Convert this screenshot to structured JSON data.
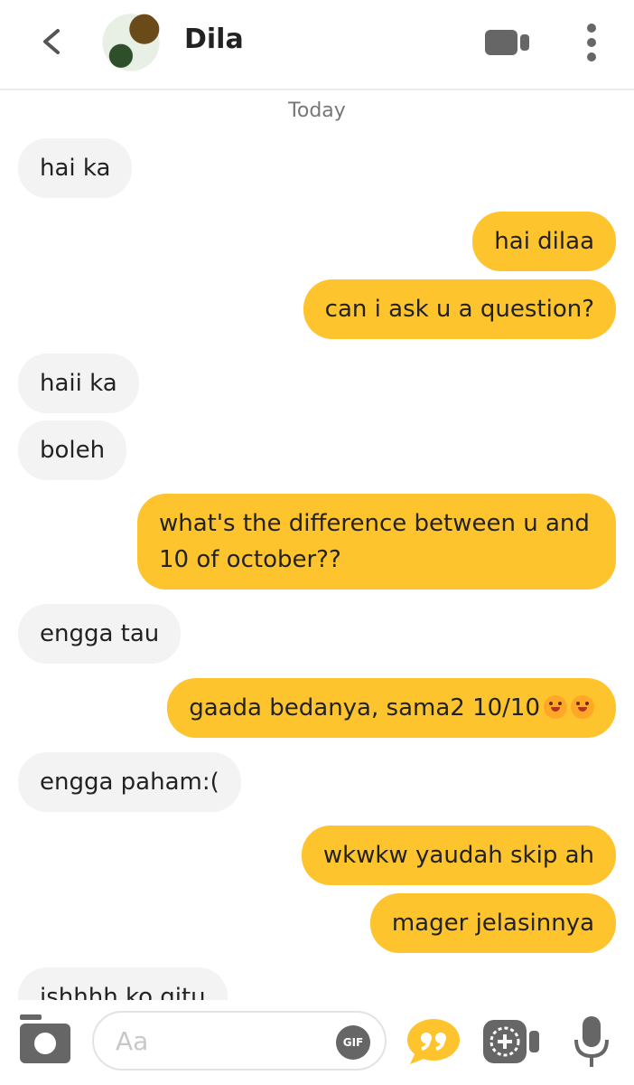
{
  "header": {
    "contact_name": "Dila"
  },
  "date_separator": "Today",
  "messages": [
    {
      "from": "contact",
      "text": "hai ka"
    },
    {
      "from": "me",
      "text": "hai dilaa"
    },
    {
      "from": "me",
      "text": "can i ask u a question?"
    },
    {
      "from": "contact",
      "text": "haii ka"
    },
    {
      "from": "contact",
      "text": "boleh"
    },
    {
      "from": "me",
      "text": "what's the difference between u and 10 of october??"
    },
    {
      "from": "contact",
      "text": "engga tau"
    },
    {
      "from": "me",
      "text": "gaada bedanya, sama2 10/10"
    },
    {
      "from": "contact",
      "text": "engga paham:("
    },
    {
      "from": "me",
      "text": "wkwkw yaudah skip ah"
    },
    {
      "from": "me",
      "text": "mager jelasinnya"
    },
    {
      "from": "contact",
      "text": "ishhhh ko gitu"
    }
  ],
  "composer": {
    "placeholder": "Aa",
    "gif_label": "GIF"
  },
  "colors": {
    "outgoing_bubble": "#fec42e",
    "incoming_bubble": "#f3f3f3",
    "accent": "#fec42e"
  },
  "icons": [
    "back-icon",
    "video-call-icon",
    "more-vertical-icon",
    "camera-icon",
    "gif-icon",
    "quote-icon",
    "video-note-icon",
    "microphone-icon",
    "smile-emoji-icon"
  ]
}
